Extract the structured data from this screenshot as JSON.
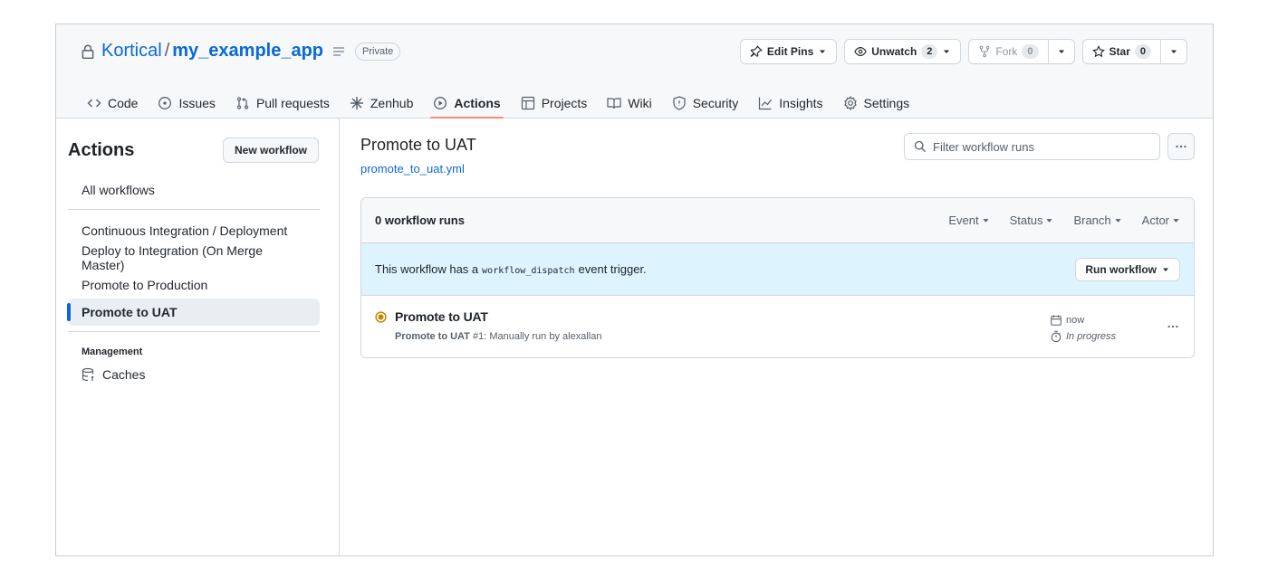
{
  "repo": {
    "owner": "Kortical",
    "separator": "/",
    "name": "my_example_app",
    "visibility": "Private"
  },
  "header_actions": {
    "edit_pins": "Edit Pins",
    "unwatch": "Unwatch",
    "unwatch_count": "2",
    "fork": "Fork",
    "fork_count": "0",
    "star": "Star",
    "star_count": "0"
  },
  "tabs": [
    {
      "label": "Code",
      "icon": "code-icon"
    },
    {
      "label": "Issues",
      "icon": "issue-opened-icon"
    },
    {
      "label": "Pull requests",
      "icon": "git-pull-request-icon"
    },
    {
      "label": "Zenhub",
      "icon": "zenhub-icon"
    },
    {
      "label": "Actions",
      "icon": "play-icon",
      "selected": true
    },
    {
      "label": "Projects",
      "icon": "table-icon"
    },
    {
      "label": "Wiki",
      "icon": "book-icon"
    },
    {
      "label": "Security",
      "icon": "shield-icon"
    },
    {
      "label": "Insights",
      "icon": "graph-icon"
    },
    {
      "label": "Settings",
      "icon": "gear-icon"
    }
  ],
  "sidebar": {
    "title": "Actions",
    "new_workflow": "New workflow",
    "all_workflows": "All workflows",
    "workflows": [
      {
        "label": "Continuous Integration / Deployment"
      },
      {
        "label": "Deploy to Integration (On Merge Master)"
      },
      {
        "label": "Promote to Production"
      },
      {
        "label": "Promote to UAT",
        "selected": true
      }
    ],
    "management_label": "Management",
    "caches": "Caches"
  },
  "main": {
    "workflow_title": "Promote to UAT",
    "workflow_file": "promote_to_uat.yml",
    "filter_placeholder": "Filter workflow runs",
    "runs_count": "0 workflow runs",
    "filters": [
      "Event",
      "Status",
      "Branch",
      "Actor"
    ],
    "dispatch": {
      "before": "This workflow has a",
      "code": "workflow_dispatch",
      "after": "event trigger.",
      "button": "Run workflow"
    },
    "run": {
      "title": "Promote to UAT",
      "workflow_name": "Promote to UAT",
      "meta": "#1: Manually run by alexallan",
      "time": "now",
      "status": "In progress",
      "status_color": "#bf8700"
    }
  },
  "colors": {
    "accent_link": "#0969da",
    "tab_underline": "#fd8c73",
    "dispatch_bg": "#ddf4ff"
  }
}
